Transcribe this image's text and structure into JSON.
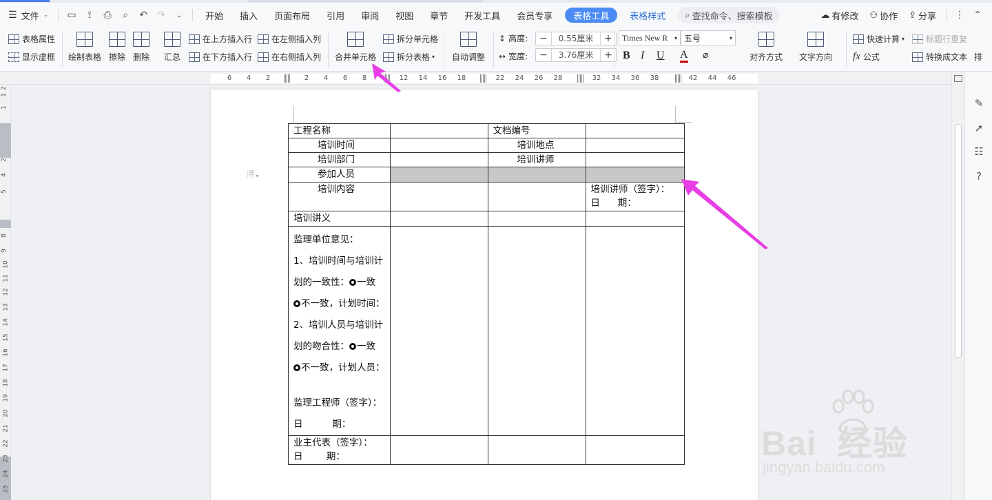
{
  "menubar": {
    "file_label": "文件",
    "tabs": [
      "开始",
      "插入",
      "页面布局",
      "引用",
      "审阅",
      "视图",
      "章节",
      "开发工具",
      "会员专享"
    ],
    "active_tab": "表格工具",
    "table_style_tab": "表格样式",
    "search_placeholder": "查找命令、搜索模板",
    "status": "有修改",
    "collab": "协作",
    "share": "分享"
  },
  "ribbon": {
    "table_props": "表格属性",
    "show_gridlines": "显示虚框",
    "draw_table": "绘制表格",
    "erase": "擦除",
    "delete": "删除",
    "summary": "汇总",
    "insert_above": "在上方插入行",
    "insert_below": "在下方插入行",
    "insert_left": "在左侧插入列",
    "insert_right": "在右侧插入列",
    "merge_cells": "合并单元格",
    "split_cells": "拆分单元格",
    "split_table": "拆分表格",
    "auto_fit": "自动调整",
    "height_label": "高度:",
    "height_value": "0.55厘米",
    "width_label": "宽度:",
    "width_value": "3.76厘米",
    "font_name": "Times New R",
    "font_size": "五号",
    "align": "对齐方式",
    "text_direction": "文字方向",
    "quick_calc": "快速计算",
    "repeat_header": "标题行重复",
    "formula": "公式",
    "to_text": "转换成文本",
    "sort": "排"
  },
  "ruler": {
    "h_numbers": [
      "6",
      "4",
      "2",
      "2",
      "4",
      "6",
      "8",
      "12",
      "14",
      "16",
      "18",
      "22",
      "24",
      "26",
      "28",
      "32",
      "34",
      "36",
      "38",
      "42",
      "44",
      "46"
    ],
    "v_numbers": [
      "2",
      "1",
      "1",
      "2",
      "4",
      "5",
      "8",
      "9",
      "10",
      "11",
      "12",
      "13",
      "14",
      "15",
      "16",
      "17",
      "18",
      "19",
      "20",
      "21",
      "22",
      "23",
      "24",
      "25"
    ]
  },
  "table": {
    "r1": [
      "工程名称",
      "",
      "文档编号",
      ""
    ],
    "r2": [
      "培训时间",
      "",
      "培训地点",
      ""
    ],
    "r3": [
      "培训部门",
      "",
      "培训讲师",
      ""
    ],
    "r4": [
      "参加人员"
    ],
    "r5": [
      "培训内容",
      "",
      "",
      "培训讲师（签字）：",
      "日      期："
    ],
    "r6": [
      "培训讲义"
    ],
    "r7": [
      "监理单位意见：",
      "1、培训时间与培训计",
      "划的一致性：",
      "一致",
      "不一致，计划时间：",
      "2、培训人员与培训计",
      "划的吻合性：",
      "一致",
      "不一致，计划人员：",
      "",
      "监理工程师（签字）：",
      "日          期："
    ],
    "r8": [
      "业主代表（签字）：",
      "日        期："
    ]
  },
  "watermark": {
    "brand": "Bai  经验",
    "url": "jingyan.baidu.com"
  }
}
